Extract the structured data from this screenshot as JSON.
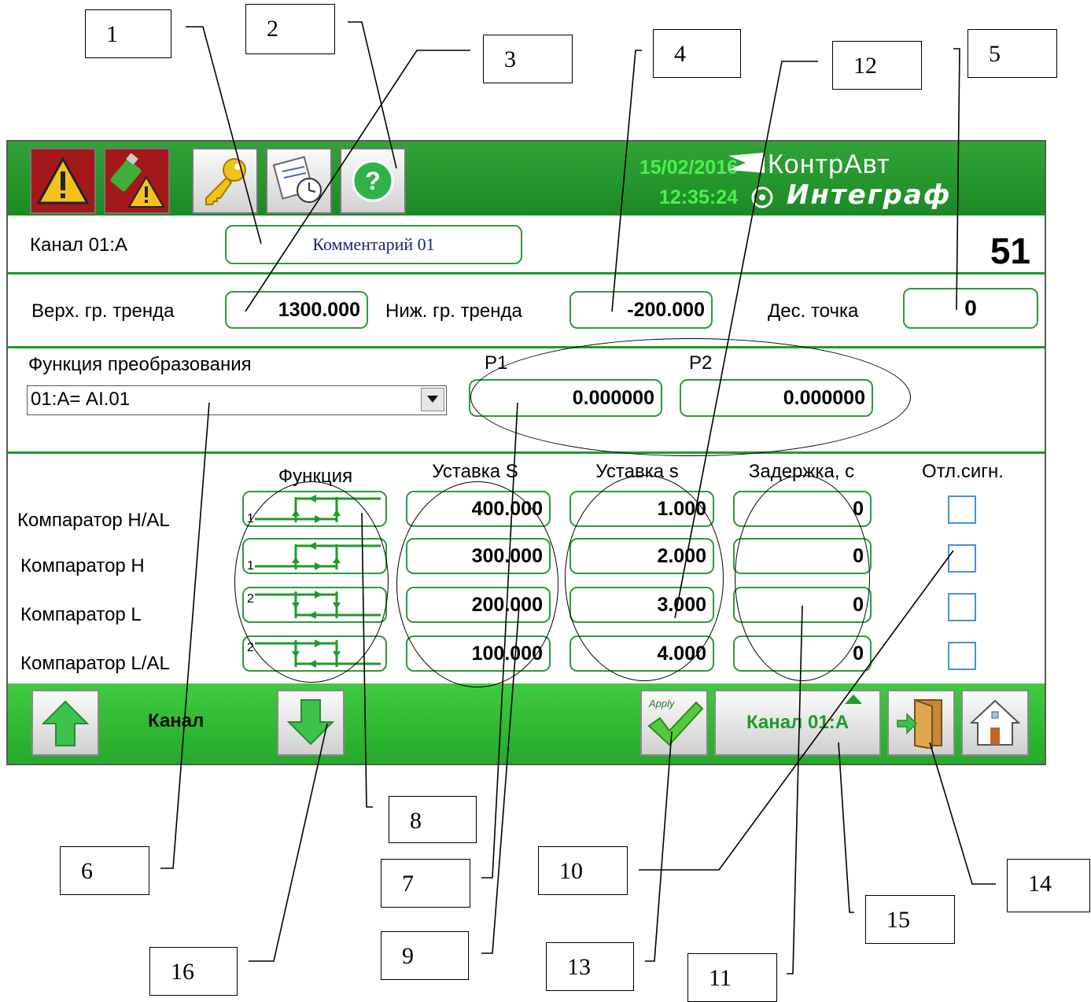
{
  "callouts": [
    "1",
    "2",
    "3",
    "4",
    "5",
    "6",
    "7",
    "8",
    "9",
    "10",
    "11",
    "12",
    "13",
    "14",
    "15",
    "16"
  ],
  "header": {
    "date": "15/02/2016",
    "time": "12:35:24",
    "brand_line1": "КонтрАвт",
    "brand_line2": "Интеграф",
    "icons": [
      "alarm-warning-icon",
      "usb-warning-icon",
      "key-icon",
      "calendar-clock-icon",
      "help-icon"
    ]
  },
  "channel": {
    "label": "Канал 01:А",
    "comment": "Комментарий 01",
    "number": "51"
  },
  "trend": {
    "upper_label": "Верх. гр. тренда",
    "upper_value": "1300.000",
    "lower_label": "Ниж. гр. тренда",
    "lower_value": "-200.000",
    "decimal_label": "Дес. точка",
    "decimal_value": "0"
  },
  "conversion": {
    "label": "Функция преобразования",
    "selected": "01:А=  AI.01",
    "p1_label": "P1",
    "p1_value": "0.000000",
    "p2_label": "P2",
    "p2_value": "0.000000"
  },
  "comparators": {
    "headers": [
      "Функция",
      "Уставка S",
      "Уставка s",
      "Задержка, с",
      "Отл.сигн."
    ],
    "rows": [
      {
        "name": "Компаратор H/AL",
        "fn_num": "1",
        "setpoint_S": "400.000",
        "setpoint_s": "1.000",
        "delay": "0",
        "checked": false
      },
      {
        "name": "Компаратор H",
        "fn_num": "1",
        "setpoint_S": "300.000",
        "setpoint_s": "2.000",
        "delay": "0",
        "checked": false
      },
      {
        "name": "Компаратор L",
        "fn_num": "2",
        "setpoint_S": "200.000",
        "setpoint_s": "3.000",
        "delay": "0",
        "checked": false
      },
      {
        "name": "Компаратор L/AL",
        "fn_num": "2",
        "setpoint_S": "100.000",
        "setpoint_s": "4.000",
        "delay": "0",
        "checked": false
      }
    ]
  },
  "footer": {
    "channel_nav_label": "Канал",
    "apply_label": "Apply",
    "channel_select": "Канал 01:А",
    "icons": [
      "arrow-up-icon",
      "arrow-down-icon",
      "apply-check-icon",
      "exit-door-icon",
      "home-icon"
    ]
  },
  "colors": {
    "bar_green": "#1c8a24",
    "footer_green": "#3fcc3f",
    "field_border": "#2f9a3c",
    "datetime": "#4df04d",
    "checkbox_border": "#4a8fe0"
  }
}
